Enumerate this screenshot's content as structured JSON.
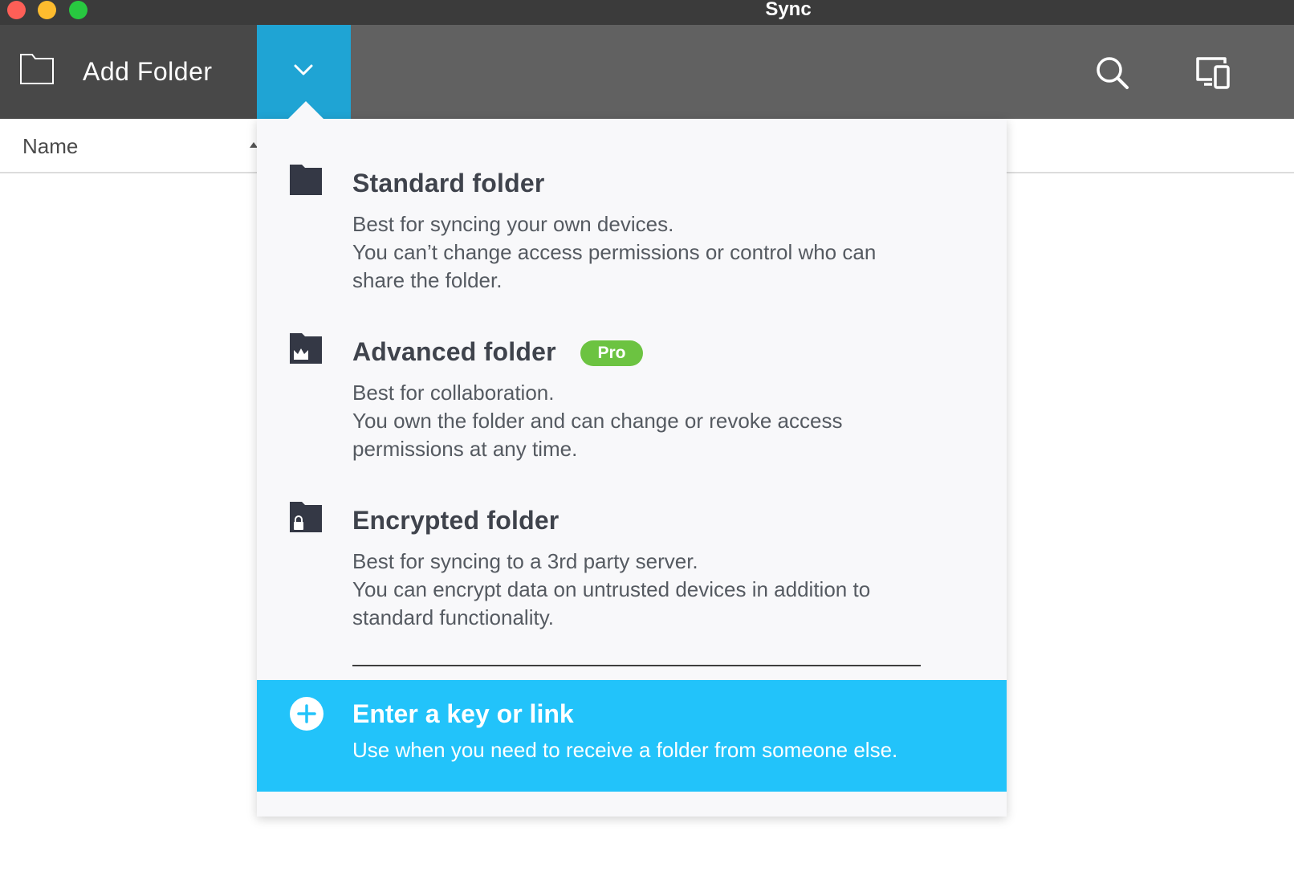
{
  "window": {
    "title": "Sync"
  },
  "toolbar": {
    "add_folder_label": "Add Folder",
    "icons": [
      "folder-outline-icon",
      "chevron-down-icon",
      "search-icon",
      "devices-icon"
    ]
  },
  "file_list": {
    "columns": [
      "Name"
    ],
    "sort": "ascending"
  },
  "menu": {
    "options": [
      {
        "title": "Standard folder",
        "icon": "folder-icon",
        "lines": [
          "Best for syncing your own devices.",
          "You can’t change access permissions or control who can",
          "share the folder."
        ]
      },
      {
        "title": "Advanced folder",
        "icon": "folder-crown-icon",
        "badge": "Pro",
        "lines": [
          "Best for collaboration.",
          "You own the folder and can change or revoke access",
          "permissions at any time."
        ]
      },
      {
        "title": "Encrypted folder",
        "icon": "folder-lock-icon",
        "lines": [
          "Best for syncing to a 3rd party server.",
          "You can encrypt data on untrusted devices in addition to",
          "standard functionality."
        ]
      }
    ],
    "key_link": {
      "title": "Enter a key or link",
      "description": "Use when you need to receive a folder from someone else.",
      "icon": "plus-circle-icon"
    }
  },
  "colors": {
    "titlebar": "#3b3b3b",
    "toolbar": "#616161",
    "toolbar_left": "#484848",
    "dropdown_toggle": "#1fa4d4",
    "menu_background": "#f8f8fa",
    "key_row": "#22c3fa",
    "pro_badge": "#6cc341",
    "folder_icon": "#343845"
  }
}
